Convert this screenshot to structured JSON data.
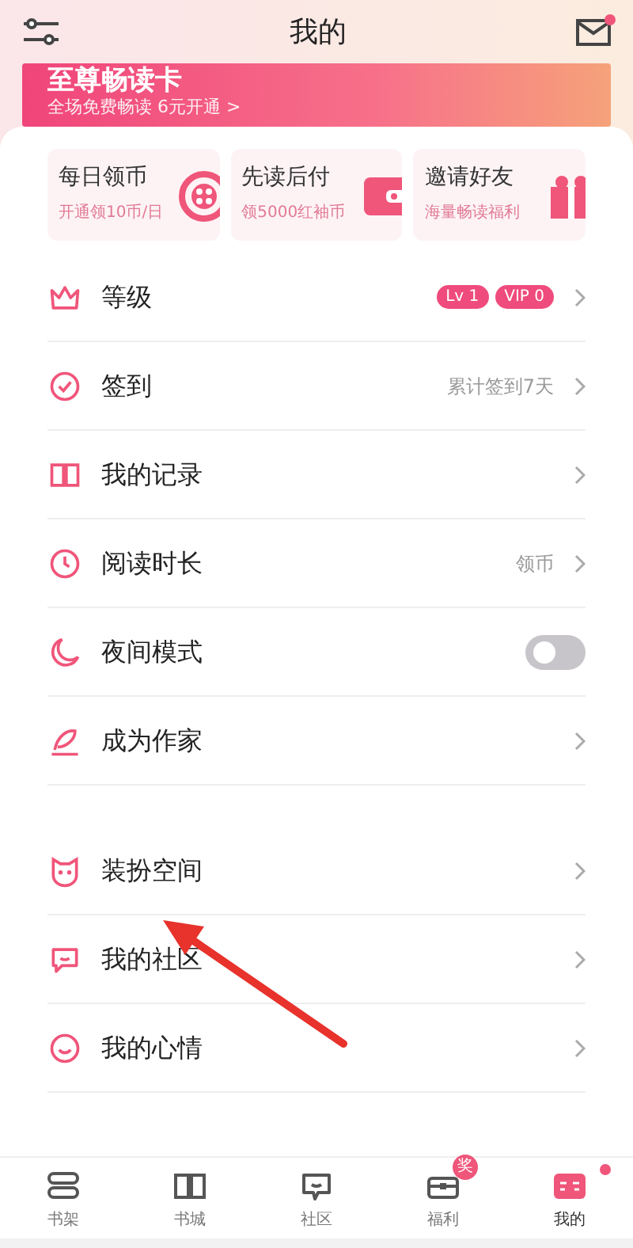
{
  "header": {
    "title": "我的",
    "mail_unread": true
  },
  "banner": {
    "title": "至尊畅读卡",
    "subtitle": "全场免费畅读  6元开通 >"
  },
  "quick_cards": [
    {
      "title": "每日领币",
      "subtitle": "开通领10币/日"
    },
    {
      "title": "先读后付",
      "subtitle": "领5000红袖币"
    },
    {
      "title": "邀请好友",
      "subtitle": "海量畅读福利"
    }
  ],
  "menu": [
    {
      "label": "等级",
      "kind": "badges",
      "badges": [
        {
          "tag": "Lv",
          "value": "1"
        },
        {
          "tag": "VIP",
          "value": "0"
        }
      ]
    },
    {
      "label": "签到",
      "kind": "text",
      "value": "累计签到7天"
    },
    {
      "label": "我的记录",
      "kind": "chevron"
    },
    {
      "label": "阅读时长",
      "kind": "text",
      "value": "领币"
    },
    {
      "label": "夜间模式",
      "kind": "toggle",
      "on": false
    },
    {
      "label": "成为作家",
      "kind": "chevron"
    },
    {
      "label": "装扮空间",
      "kind": "chevron",
      "group_start": true
    },
    {
      "label": "我的社区",
      "kind": "chevron"
    },
    {
      "label": "我的心情",
      "kind": "chevron"
    }
  ],
  "tabs": [
    {
      "label": "书架",
      "selected": false
    },
    {
      "label": "书城",
      "selected": false
    },
    {
      "label": "社区",
      "selected": false
    },
    {
      "label": "福利",
      "selected": false,
      "badge": "奖"
    },
    {
      "label": "我的",
      "selected": true,
      "dot": true
    }
  ]
}
